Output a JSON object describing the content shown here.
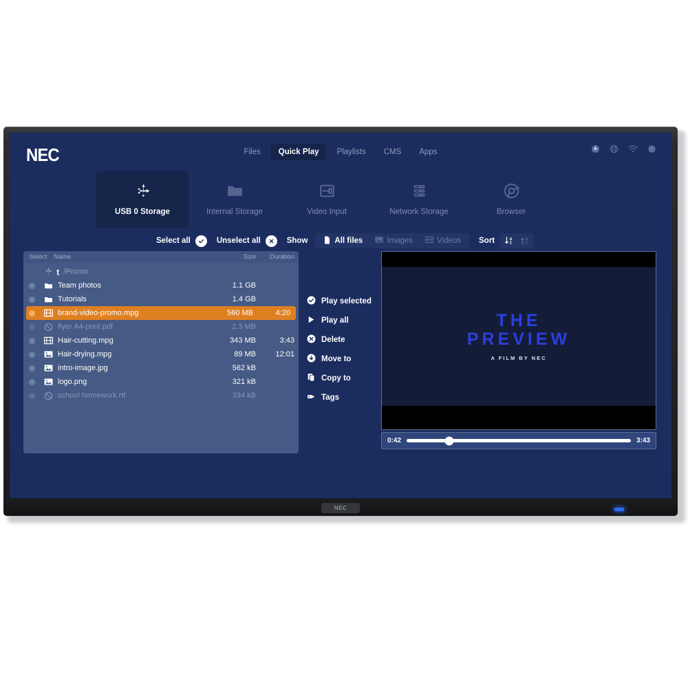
{
  "device": {
    "brand": "NEC",
    "bottom_logo": "NEC",
    "led_color": "#2a6bf5"
  },
  "colors": {
    "screen_bg": "#1b2c5e",
    "panel_bg": "#455a84",
    "accent_selected": "#df8020",
    "active_tab_bg": "#152449",
    "muted_text": "#8e9bbd"
  },
  "topbar": {
    "logo": "NEC",
    "nav": [
      {
        "label": "Files",
        "active": false
      },
      {
        "label": "Quick Play",
        "active": true
      },
      {
        "label": "Playlists",
        "active": false
      },
      {
        "label": "CMS",
        "active": false
      },
      {
        "label": "Apps",
        "active": false
      }
    ],
    "status_icons": [
      {
        "name": "download-icon"
      },
      {
        "name": "globe-icon"
      },
      {
        "name": "wifi-icon"
      },
      {
        "name": "gear-icon"
      }
    ]
  },
  "sources": [
    {
      "label": "USB 0 Storage",
      "icon": "usb-icon",
      "active": true
    },
    {
      "label": "Internal Storage",
      "icon": "folder-icon",
      "active": false
    },
    {
      "label": "Video Input",
      "icon": "video-input-icon",
      "active": false
    },
    {
      "label": "Network Storage",
      "icon": "server-icon",
      "active": false
    },
    {
      "label": "Browser",
      "icon": "chrome-icon",
      "active": false
    }
  ],
  "toolbar": {
    "select_all_label": "Select all",
    "unselect_all_label": "Unselect all",
    "show_label": "Show",
    "filters": [
      {
        "label": "All files",
        "icon": "file-icon",
        "active": true
      },
      {
        "label": "Images",
        "icon": "image-icon",
        "active": false
      },
      {
        "label": "Videos",
        "icon": "film-icon",
        "active": false
      }
    ],
    "sort_label": "Sort",
    "sort_buttons": [
      {
        "name": "sort-az-icon",
        "active": true
      },
      {
        "name": "sort-za-icon",
        "active": false
      }
    ]
  },
  "filelist": {
    "headers": {
      "select": "Select",
      "name": "Name",
      "size": "Size",
      "duration": "Duration"
    },
    "breadcrumb": {
      "up": "t",
      "path": "/Promo",
      "icon": "usb-icon"
    },
    "rows": [
      {
        "name": "Team photos",
        "size": "1.1 GB",
        "duration": "",
        "icon": "folder-icon",
        "selected": false,
        "disabled": false
      },
      {
        "name": "Tutorials",
        "size": "1.4 GB",
        "duration": "",
        "icon": "folder-icon",
        "selected": false,
        "disabled": false
      },
      {
        "name": "brand-video-promo.mpg",
        "size": "560 MB",
        "duration": "4:20",
        "icon": "film-icon",
        "selected": true,
        "disabled": false
      },
      {
        "name": "flyer A4-print.pdf",
        "size": "2.3 MB",
        "duration": "",
        "icon": "blocked-icon",
        "selected": false,
        "disabled": true
      },
      {
        "name": "Hair-cutting.mpg",
        "size": "343 MB",
        "duration": "3:43",
        "icon": "film-icon",
        "selected": false,
        "disabled": false
      },
      {
        "name": "Hair-drying.mpg",
        "size": "89 MB",
        "duration": "12:01",
        "icon": "image-icon",
        "selected": false,
        "disabled": false
      },
      {
        "name": "intro-image.jpg",
        "size": "562 kB",
        "duration": "",
        "icon": "image-icon",
        "selected": false,
        "disabled": false
      },
      {
        "name": "logo.png",
        "size": "321 kB",
        "duration": "",
        "icon": "image-icon",
        "selected": false,
        "disabled": false
      },
      {
        "name": "school homework.rtf",
        "size": "334 kB",
        "duration": "",
        "icon": "blocked-icon",
        "selected": false,
        "disabled": true
      }
    ]
  },
  "actions": [
    {
      "label": "Play selected",
      "icon": "check-circle-icon"
    },
    {
      "label": "Play all",
      "icon": "play-icon"
    },
    {
      "label": "Delete",
      "icon": "x-circle-icon"
    },
    {
      "label": "Move to",
      "icon": "move-icon"
    },
    {
      "label": "Copy to",
      "icon": "copy-icon"
    },
    {
      "label": "Tags",
      "icon": "tag-icon"
    }
  ],
  "preview": {
    "title_line1": "THE",
    "title_line2": "PREVIEW",
    "subtitle": "A FILM BY NEC",
    "current_time": "0:42",
    "total_time": "3:43",
    "progress_percent": 19
  }
}
